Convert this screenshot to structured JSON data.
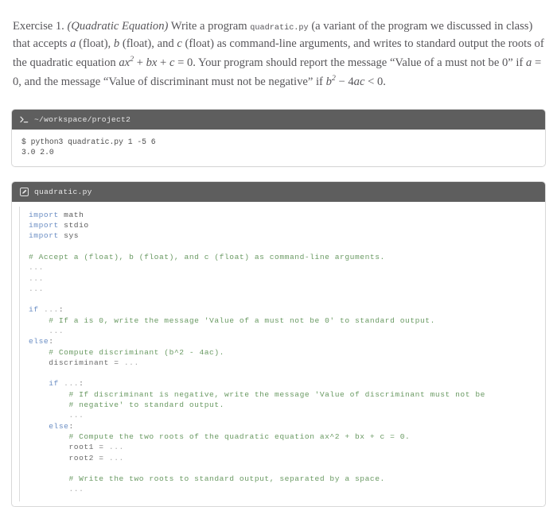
{
  "exercise": {
    "label": "Exercise 1.",
    "title": "(Quadratic Equation)",
    "text_part1": "Write a program",
    "inline_code": "quadratic.py",
    "text_part2": "(a variant of the program we discussed in class) that accepts",
    "var_a": "a",
    "type_a": "(float),",
    "var_b": "b",
    "type_b": "(float), and",
    "var_c": "c",
    "type_c": "(float) as command-line arguments, and writes to standard output the roots of the quadratic equation",
    "equation": "ax2 + bx + c = 0.",
    "text_part3": "Your program should report the message",
    "message_a": "“Value of a must not be 0”",
    "text_part4": "if",
    "cond_a": "a = 0,",
    "text_part5": "and the message",
    "message_d": "“Value of discriminant must not be negative”",
    "text_part6": "if",
    "cond_d": "b2 − 4ac < 0."
  },
  "terminal": {
    "icon": "prompt-icon",
    "prompt_glyph": ">_",
    "path": "~/workspace/project2",
    "lines": [
      "$ python3 quadratic.py 1 -5 6",
      "3.0 2.0"
    ]
  },
  "editor": {
    "icon": "pencil-icon",
    "filename": "quadratic.py",
    "code_lines": [
      [
        {
          "t": "import",
          "c": "kw"
        },
        {
          "t": " math",
          "c": "txt"
        }
      ],
      [
        {
          "t": "import",
          "c": "kw"
        },
        {
          "t": " stdio",
          "c": "txt"
        }
      ],
      [
        {
          "t": "import",
          "c": "kw"
        },
        {
          "t": " sys",
          "c": "txt"
        }
      ],
      [],
      [
        {
          "t": "# Accept a (float), b (float), and c (float) as command-line arguments.",
          "c": "com"
        }
      ],
      [
        {
          "t": "...",
          "c": "dots"
        }
      ],
      [
        {
          "t": "...",
          "c": "dots"
        }
      ],
      [
        {
          "t": "...",
          "c": "dots"
        }
      ],
      [],
      [
        {
          "t": "if",
          "c": "kw"
        },
        {
          "t": " ",
          "c": "plain"
        },
        {
          "t": "...",
          "c": "dots"
        },
        {
          "t": ":",
          "c": "plain"
        }
      ],
      [
        {
          "t": "    # If a is 0, write the message 'Value of a must not be 0' to standard output.",
          "c": "com"
        }
      ],
      [
        {
          "t": "    ",
          "c": "plain"
        },
        {
          "t": "...",
          "c": "dots"
        }
      ],
      [
        {
          "t": "else",
          "c": "kw"
        },
        {
          "t": ":",
          "c": "plain"
        }
      ],
      [
        {
          "t": "    # Compute discriminant (b^2 - 4ac).",
          "c": "com"
        }
      ],
      [
        {
          "t": "    discriminant = ",
          "c": "plain"
        },
        {
          "t": "...",
          "c": "dots"
        }
      ],
      [],
      [
        {
          "t": "    ",
          "c": "plain"
        },
        {
          "t": "if",
          "c": "kw"
        },
        {
          "t": " ",
          "c": "plain"
        },
        {
          "t": "...",
          "c": "dots"
        },
        {
          "t": ":",
          "c": "plain"
        }
      ],
      [
        {
          "t": "        # If discriminant is negative, write the message 'Value of discriminant must not be",
          "c": "com"
        }
      ],
      [
        {
          "t": "        # negative' to standard output.",
          "c": "com"
        }
      ],
      [
        {
          "t": "        ",
          "c": "plain"
        },
        {
          "t": "...",
          "c": "dots"
        }
      ],
      [
        {
          "t": "    ",
          "c": "plain"
        },
        {
          "t": "else",
          "c": "kw"
        },
        {
          "t": ":",
          "c": "plain"
        }
      ],
      [
        {
          "t": "        # Compute the two roots of the quadratic equation ax^2 + bx + c = 0.",
          "c": "com"
        }
      ],
      [
        {
          "t": "        root1 = ",
          "c": "plain"
        },
        {
          "t": "...",
          "c": "dots"
        }
      ],
      [
        {
          "t": "        root2 = ",
          "c": "plain"
        },
        {
          "t": "...",
          "c": "dots"
        }
      ],
      [],
      [
        {
          "t": "        # Write the two roots to standard output, separated by a space.",
          "c": "com"
        }
      ],
      [
        {
          "t": "        ",
          "c": "plain"
        },
        {
          "t": "...",
          "c": "dots"
        }
      ]
    ]
  },
  "colors": {
    "header_bar": "#5e5e5e",
    "keyword": "#6b8ec4",
    "comment": "#6a9a63",
    "placeholder": "#a9a9a9",
    "prose": "#57565a"
  }
}
